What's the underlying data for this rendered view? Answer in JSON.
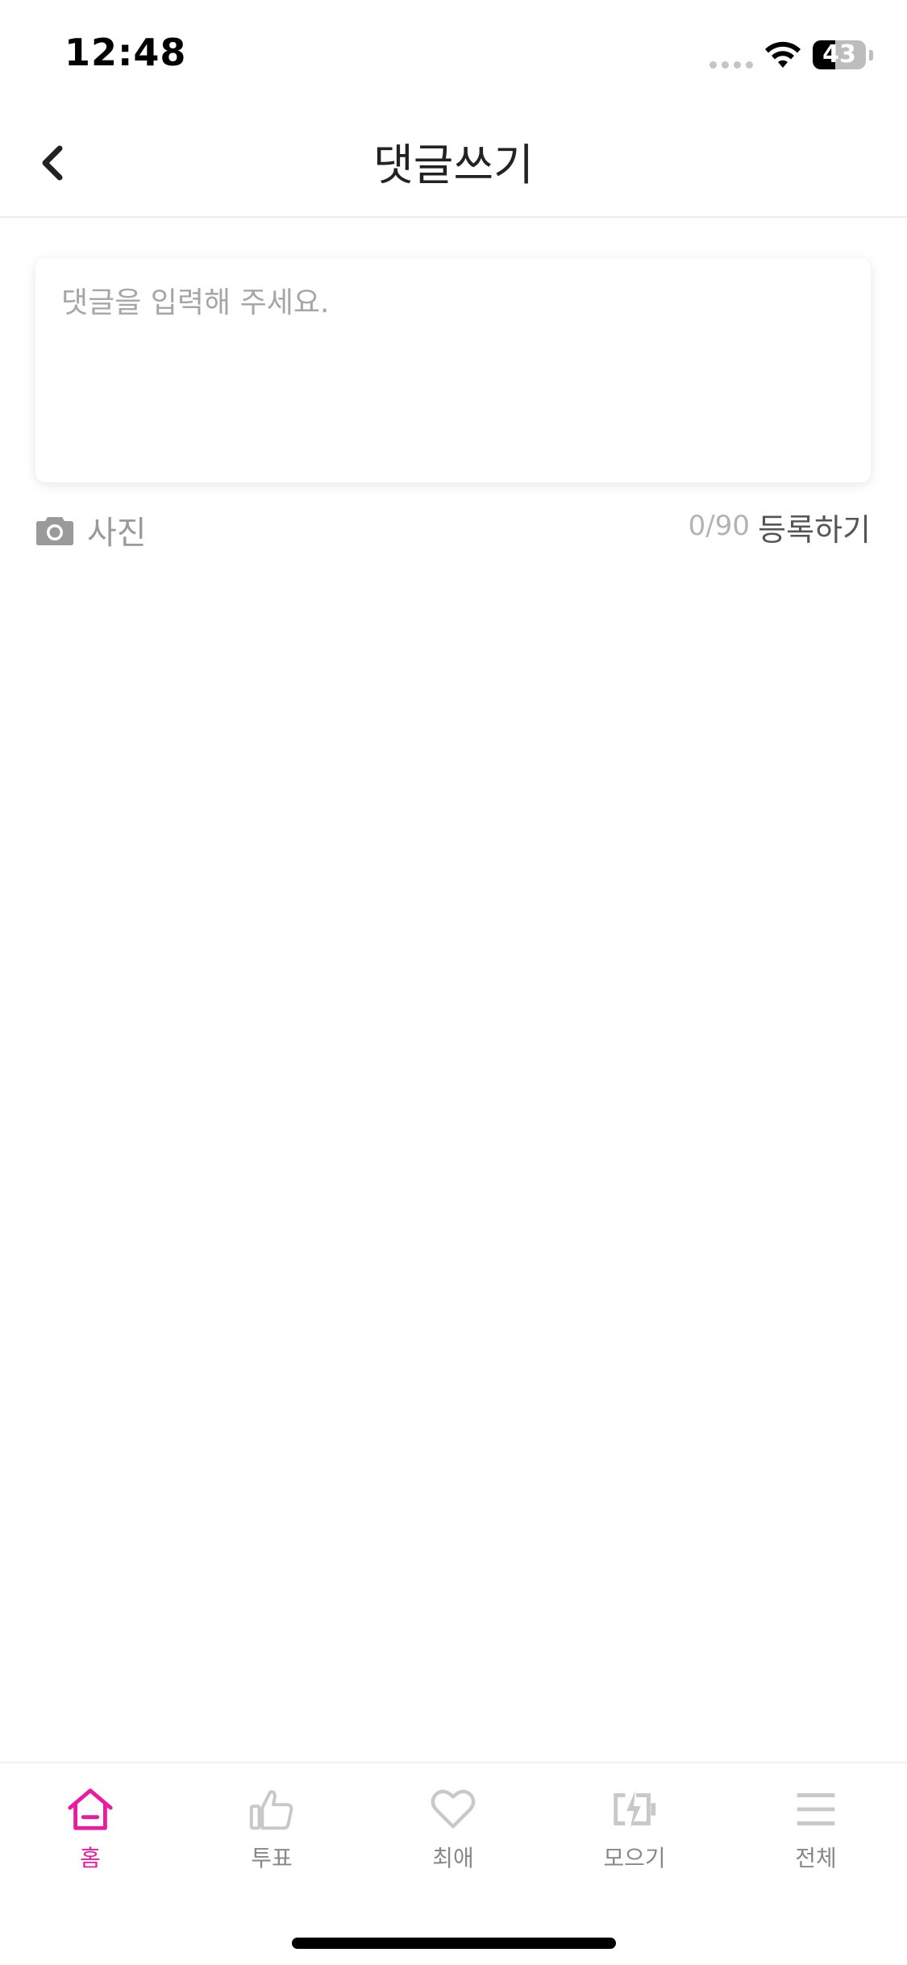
{
  "status_bar": {
    "time": "12:48",
    "battery_level": "43",
    "battery_fraction": 0.43,
    "icons": [
      "cellular-signal-icon",
      "wifi-icon",
      "battery-icon"
    ]
  },
  "header": {
    "title": "댓글쓰기",
    "back_icon": "chevron-left-icon"
  },
  "comment": {
    "placeholder": "댓글을 입력해 주세요.",
    "value": ""
  },
  "toolbar": {
    "photo_icon": "camera-icon",
    "photo_label": "사진",
    "counter": "0/90",
    "submit_label": "등록하기"
  },
  "bottom_nav": {
    "items": [
      {
        "label": "홈",
        "icon": "home-icon",
        "active": true
      },
      {
        "label": "투표",
        "icon": "thumbs-up-icon",
        "active": false
      },
      {
        "label": "최애",
        "icon": "heart-icon",
        "active": false
      },
      {
        "label": "모으기",
        "icon": "battery-charge-icon",
        "active": false
      },
      {
        "label": "전체",
        "icon": "menu-icon",
        "active": false
      }
    ]
  },
  "colors": {
    "accent": "#e91ba0",
    "inactive": "#c8c8c8",
    "text": "#222222",
    "placeholder": "#a6a6a6"
  }
}
